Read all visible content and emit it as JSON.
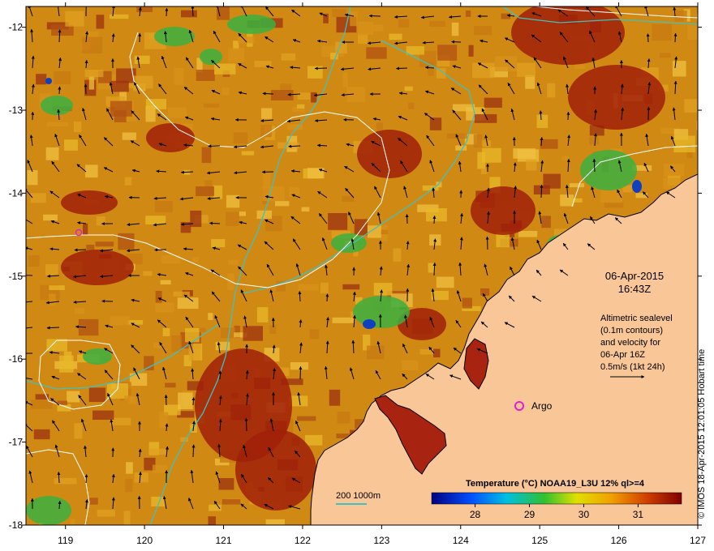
{
  "map": {
    "date": "06-Apr-2015",
    "time": "16:43Z",
    "altimetry_note_lines": [
      "Altimetric sealevel",
      "(0.1m contours)",
      "and velocity for",
      "06-Apr 16Z",
      "0.5m/s (1kt 24h)"
    ],
    "argo_label": "Argo",
    "credit": "© IMOS 18-Apr-2015 12:01:05 Hobart time",
    "lon_ticks": [
      "119",
      "120",
      "121",
      "122",
      "123",
      "124",
      "125",
      "126",
      "127"
    ],
    "lat_ticks": [
      "-12",
      "-13",
      "-14",
      "-15",
      "-16",
      "-17",
      "-18"
    ],
    "colorbar": {
      "title": "Temperature (°C) NOAA19_L3U 12% ql>=4",
      "ticks": [
        "28",
        "29",
        "30",
        "31"
      ],
      "range": [
        27.2,
        31.8
      ]
    },
    "bathymetry_legend": "200  1000m",
    "colors": {
      "land": "#f9c698",
      "sst_base": "#d08a14",
      "warm": "#a02008",
      "cool": "#3cb040",
      "bathy_contour": "#40c0c0",
      "argo_marker": "#e020d0"
    }
  }
}
